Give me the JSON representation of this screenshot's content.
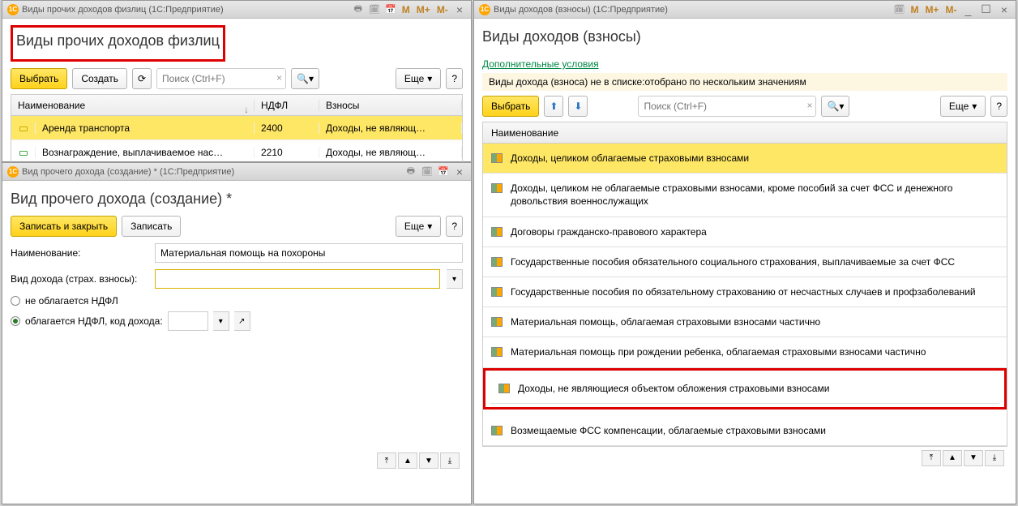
{
  "leftTop": {
    "windowTitle": "Виды прочих доходов физлиц  (1С:Предприятие)",
    "pageTitle": "Виды прочих доходов физлиц",
    "toolbar": {
      "select": "Выбрать",
      "create": "Создать",
      "searchPlaceholder": "Поиск (Ctrl+F)",
      "more": "Еще",
      "help": "?"
    },
    "columns": {
      "name": "Наименование",
      "ndfl": "НДФЛ",
      "contrib": "Взносы"
    },
    "rows": [
      {
        "name": "Аренда транспорта",
        "ndfl": "2400",
        "contrib": "Доходы, не являющ…",
        "selected": true
      },
      {
        "name": "Вознаграждение, выплачиваемое нас…",
        "ndfl": "2210",
        "contrib": "Доходы, не являющ…",
        "selected": false
      }
    ]
  },
  "leftBot": {
    "windowTitle": "Вид прочего дохода (создание) *  (1С:Предприятие)",
    "pageTitle": "Вид прочего дохода (создание) *",
    "toolbar": {
      "saveClose": "Записать и закрыть",
      "save": "Записать",
      "more": "Еще",
      "help": "?"
    },
    "fields": {
      "nameLabel": "Наименование:",
      "nameValue": "Материальная помощь на похороны",
      "contribTypeLabel": "Вид дохода (страх. взносы):",
      "radio1": "не облагается НДФЛ",
      "radio2": "облагается НДФЛ, код дохода:",
      "radio2Checked": true
    }
  },
  "right": {
    "windowTitleFrag": "Виды доходов (взносы)  (1С:Предприятие)",
    "pageTitle": "Виды доходов (взносы)",
    "extraLink": "Дополнительные условия",
    "filterNote": "Виды дохода (взноса) не в списке:отобрано по нескольким значениям",
    "toolbar": {
      "select": "Выбрать",
      "searchPlaceholder": "Поиск (Ctrl+F)",
      "more": "Еще",
      "help": "?"
    },
    "listHeader": "Наименование",
    "items": [
      {
        "text": "Доходы, целиком облагаемые страховыми взносами",
        "selected": true
      },
      {
        "text": "Доходы, целиком не облагаемые страховыми взносами, кроме пособий за счет ФСС и денежного довольствия военнослужащих"
      },
      {
        "text": "Договоры гражданско-правового характера"
      },
      {
        "text": "Государственные пособия обязательного социального страхования, выплачиваемые за счет ФСС"
      },
      {
        "text": "Государственные пособия по обязательному страхованию от несчастных случаев и профзаболеваний"
      },
      {
        "text": "Материальная помощь, облагаемая страховыми взносами частично"
      },
      {
        "text": "Материальная помощь при рождении ребенка, облагаемая страховыми взносами частично"
      },
      {
        "text": "Доходы, не являющиеся объектом обложения страховыми взносами",
        "highlighted": true
      },
      {
        "text": "Возмещаемые ФСС компенсации, облагаемые страховыми взносами"
      }
    ]
  },
  "titlebarIcons": {
    "mLabels": [
      "M",
      "M+",
      "M-"
    ]
  }
}
